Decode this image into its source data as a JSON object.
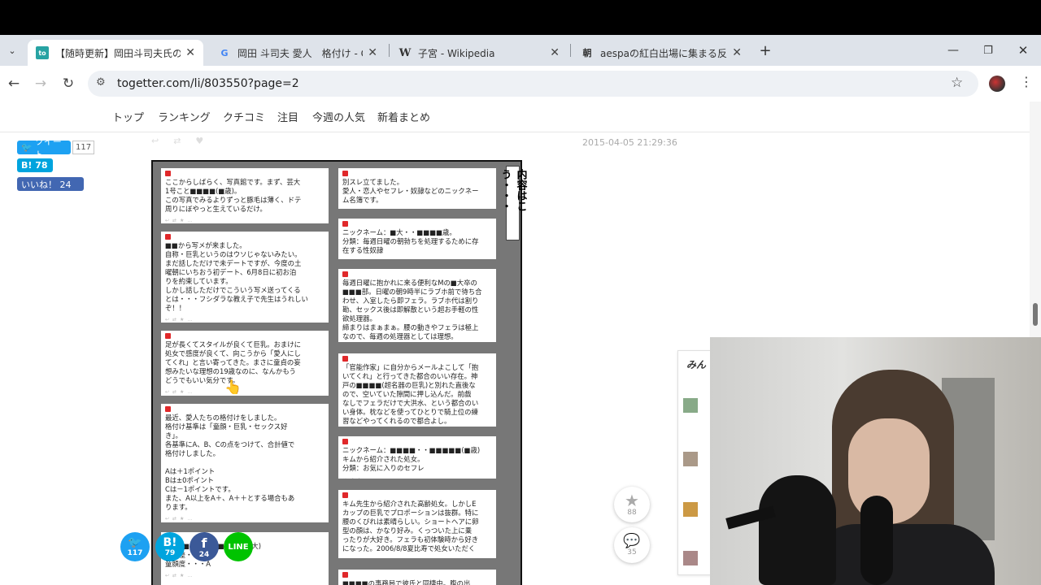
{
  "tabs": [
    {
      "title": "【随時更新】岡田斗司夫氏の暴露",
      "active": true,
      "favicon": "to"
    },
    {
      "title": "岡田 斗司夫 愛人　格付け - Goo",
      "active": false,
      "favicon": "G"
    },
    {
      "title": "子宮 - Wikipedia",
      "active": false,
      "favicon": "W"
    },
    {
      "title": "aespaの紅白出場に集まる反対署",
      "active": false,
      "favicon": "朝"
    }
  ],
  "address": {
    "url": "togetter.com/li/803550?page=2"
  },
  "site_nav": [
    "トップ",
    "ランキング",
    "クチコミ",
    "注目",
    "今週の人気",
    "新着まとめ"
  ],
  "share": {
    "tweet_label": "ツイート",
    "tweet_count": "117",
    "hatena_label": "B! 78",
    "like_label": "いいね！ 24"
  },
  "timestamp": "2015-04-05 21:29:36",
  "image_side_label": "内容はこう・・・",
  "cards_left": [
    {
      "lines": [
        "ここからしばらく、写真館です。まず、芸大",
        "1号こと■■■■(■歳)。",
        "この写真でみるよりずっと豚毛は薄く、ドテ",
        "周りにぼやっと生えているだけ。"
      ]
    },
    {
      "lines": [
        "■■から写メが来ました。",
        "自称・巨乳というのはウソじゃないみたい。",
        "まだ話しただけで未デートですが、今度の土",
        "曜朝にいちおう初デート、6月8日に初お泊",
        "りを約束しています。",
        "しかし話しただけでこういう写メ送ってくる",
        "とは・・・フシダラな教え子で先生はうれしい",
        "ぞ！！"
      ]
    },
    {
      "lines": [
        "足が長くてスタイルが良くて巨乳。おまけに",
        "処女で感度が良くて、向こうから「愛人にし",
        "てくれ」と言い寄ってきた。まさに童貞の妄",
        "想みたいな理想の19歳なのに、なんかもう",
        "どうでもいい気分です。"
      ]
    },
    {
      "lines": [
        "最近、愛人たちの格付けをしました。",
        "格付け基準は「童顔・巨乳・セックス好",
        "き」。",
        "各基準にA、B、Cの点をつけて、合計値で",
        "格付けしました。",
        "",
        "Aは＋1ポイント",
        "Bは±0ポイント",
        "Cは－1ポイントです。",
        "また、A以上をA＋、A＋＋とする場合もあ",
        "ります。"
      ]
    },
    {
      "lines": [
        "（9）■■■■■(■歳・元芸大)",
        "年齢差・・・A",
        "童顔度・・・A"
      ]
    }
  ],
  "cards_right": [
    {
      "lines": [
        "別スレ立てました。",
        "愛人・恋人やセフレ・奴隷などのニックネー",
        "ム名簿です。"
      ]
    },
    {
      "lines": [
        "ニックネーム：■大・・■■■■歳。",
        "分類：毎週日曜の朝勃ちを処理するために存",
        "在する性奴隷"
      ]
    },
    {
      "lines": [
        "毎週日曜に抱かれに来る便利なMの■大卒の",
        "■■■部。日曜の朝9時半にラブホ前で待ち合",
        "わせ、入室したら即フェラ。ラブホ代は割り",
        "勘、セックス後は即解散という超お手軽の性",
        "欲処理器。",
        "締まりはまぁまぁ。腰の動きやフェラは極上",
        "なので、毎週の処理器としては理想。"
      ]
    },
    {
      "lines": [
        "「官能作家」に自分からメールよこして「抱",
        "いてくれ」と行ってきた都合のいい存在。神",
        "戸の■■■■(超名器の巨乳)と別れた直後な",
        "ので、空いていた隙間に押し込んだ。前戯",
        "なしでフェラだけで大洪水、という都合のい",
        "い身体。枕などを使ってひとりで騎上位の練",
        "習などやってくれるので都合よし。"
      ]
    },
    {
      "lines": [
        "ニックネーム：■■■■・・■■■■■(■歳)",
        "キムから紹介された処女。",
        "分類：お気に入りのセフレ"
      ]
    },
    {
      "lines": [
        "キム先生から紹介された高齢処女。しかしE",
        "カップの巨乳でプロポーションは抜群。特に",
        "腰のくびれは素晴らしい。ショートヘアに卵",
        "型の顔は、かなり好み。くっついた上に乗",
        "ったりが大好き。フェラも初体験時から好き",
        "になった。2006/8/8夏比寿で処女いただく"
      ]
    },
    {
      "lines": [
        "■■■■の事務局で彼氏と同棲中。腹の出"
      ]
    }
  ],
  "floating": {
    "star_count": "88",
    "comment_count": "35"
  },
  "bottom_share": {
    "twitter_count": "117",
    "hatena_count": "79",
    "facebook_count": "24"
  },
  "right_panel": {
    "heading": "みん"
  },
  "colors": {
    "twitter": "#1da1f2",
    "hatena": "#00a4de",
    "facebook": "#3b5998",
    "line": "#00c300",
    "tab_bg": "#dee3ea"
  }
}
